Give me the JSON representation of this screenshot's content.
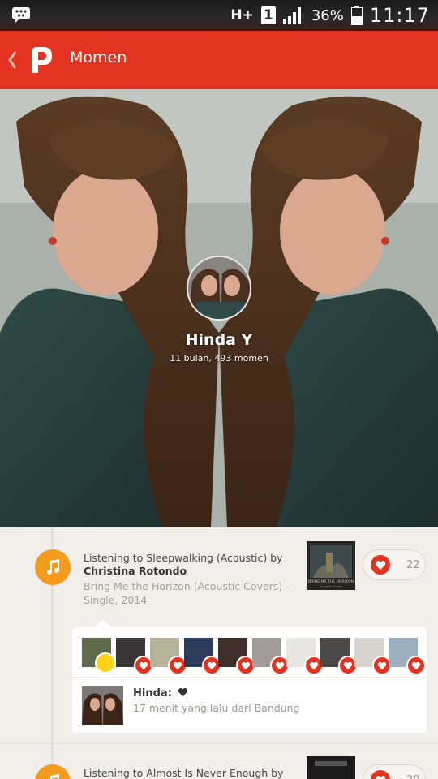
{
  "status_bar": {
    "network": "H+",
    "sim": "1",
    "battery": "36%",
    "time": "11:17"
  },
  "app_bar": {
    "title": "Momen"
  },
  "profile": {
    "name": "Hinda Y",
    "stats": "11 bulan, 493 momen"
  },
  "moments": [
    {
      "title_prefix": "Listening to Sleepwalking (Acoustic) by",
      "artist": "Christina Rotondo",
      "album": "Bring Me the Horizon (Acoustic Covers) - Single, 2014",
      "love_count": "22",
      "album_art_text": "BRING ME THE HORIZON",
      "album_art_sub": "Acoustic Covers"
    },
    {
      "title_prefix": "Listening to Almost Is Never Enough by",
      "love_count": "20"
    }
  ],
  "comment": {
    "author": "Hinda:",
    "meta": "17 menit yang lalu dari Bandung"
  },
  "colors": {
    "accent": "#e3321f",
    "music": "#f49a1d"
  }
}
